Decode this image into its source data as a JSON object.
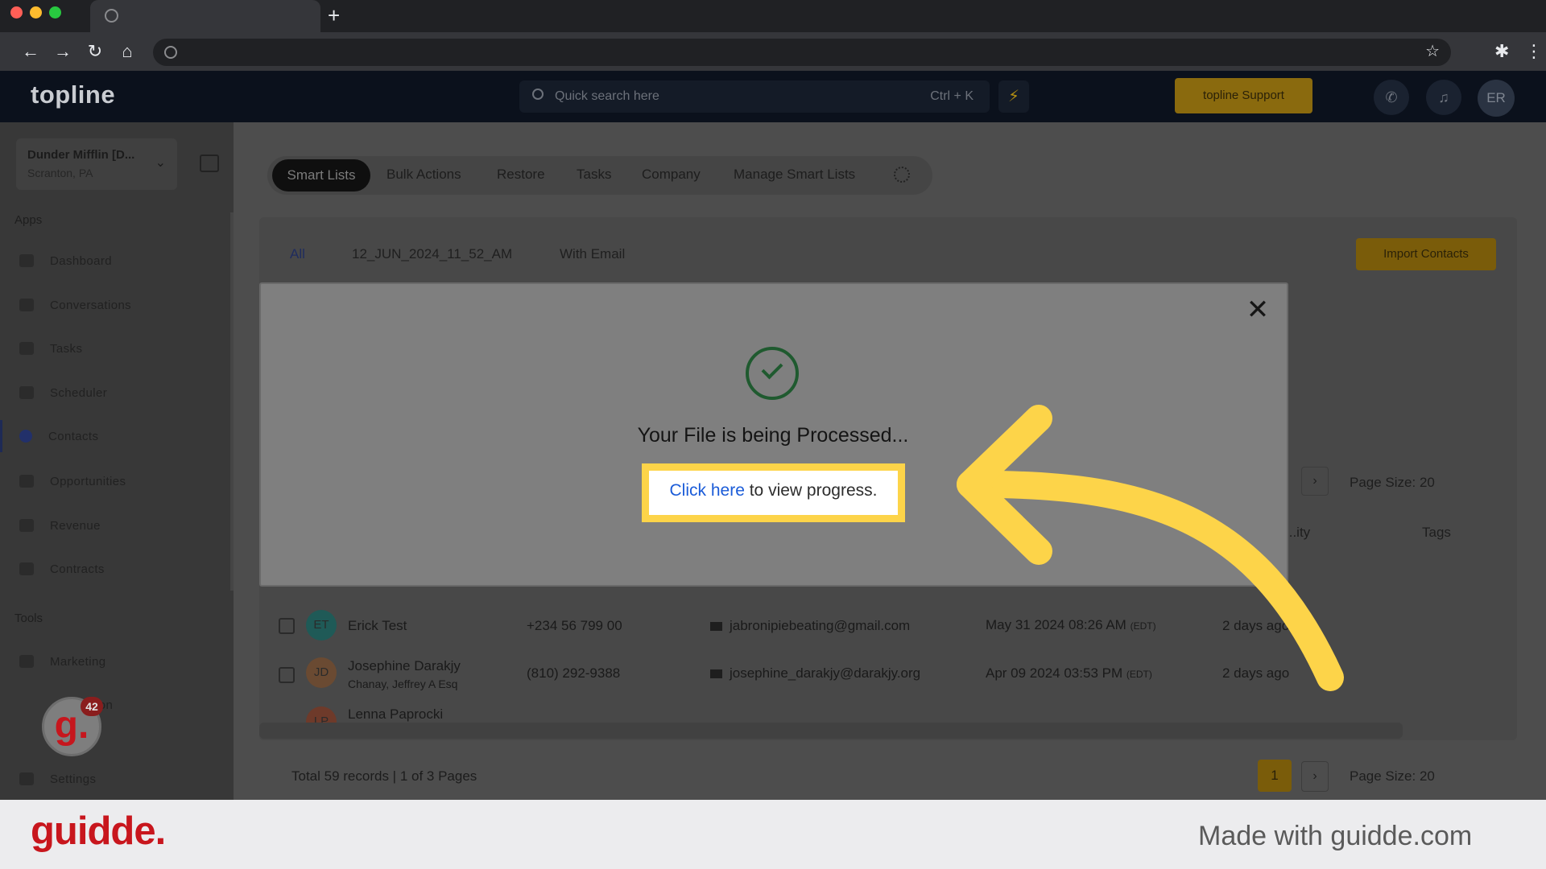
{
  "browser": {
    "new_tab_glyph": "+",
    "back_icon": "arrow-left-icon",
    "forward_icon": "arrow-right-icon"
  },
  "header": {
    "logo": "topline",
    "search_placeholder": "Quick search here",
    "search_shortcut": "Ctrl + K",
    "support_label": "topline Support",
    "avatar_initials": "ER"
  },
  "sidebar": {
    "location_name": "Dunder Mifflin [D...",
    "location_sub": "Scranton, PA",
    "apps_label": "Apps",
    "tools_label": "Tools",
    "items": [
      {
        "label": "Dashboard"
      },
      {
        "label": "Conversations"
      },
      {
        "label": "Tasks"
      },
      {
        "label": "Scheduler"
      },
      {
        "label": "Contacts"
      },
      {
        "label": "Opportunities"
      },
      {
        "label": "Revenue"
      },
      {
        "label": "Contracts"
      }
    ],
    "tool_items": [
      {
        "label": "Marketing"
      },
      {
        "label": "...ation"
      },
      {
        "label": "Settings"
      }
    ]
  },
  "tabs": {
    "active": "Smart Lists",
    "items": [
      "Bulk Actions",
      "Restore",
      "Tasks",
      "Company",
      "Manage Smart Lists"
    ]
  },
  "filters": {
    "all": "All",
    "list1": "12_JUN_2024_11_52_AM",
    "list2": "With Email",
    "import_label": "Import Contacts"
  },
  "table": {
    "page_size": "Page Size: 20",
    "activity_head": "...ity",
    "tags_head": "Tags",
    "rows": [
      {
        "initials": "ET",
        "name": "Erick Test",
        "sub": "",
        "phone": "+234 56 799 00",
        "email": "jabronipiebeating@gmail.com",
        "date": "May 31 2024 08:26 AM",
        "tz": "(EDT)",
        "activity": "2 days ago",
        "avatar_color": "#1f5a57"
      },
      {
        "initials": "JD",
        "name": "Josephine Darakjy",
        "sub": "Chanay, Jeffrey A Esq",
        "phone": "(810) 292-9388",
        "email": "josephine_darakjy@darakjy.org",
        "date": "Apr 09 2024 03:53 PM",
        "tz": "(EDT)",
        "activity": "2 days ago",
        "avatar_color": "#6a4a32"
      },
      {
        "initials": "LP",
        "name": "Lenna Paprocki",
        "sub": "",
        "phone": "",
        "email": "",
        "date": "",
        "tz": "",
        "activity": "",
        "avatar_color": "#6e3a2a"
      }
    ],
    "footer_total": "Total 59 records | 1 of 3 Pages",
    "current_page": "1",
    "next_glyph": "›"
  },
  "modal": {
    "title": "Your File is being Processed...",
    "link_text": "Click here",
    "rest_text": " to view progress.",
    "close_glyph": "✕"
  },
  "widget": {
    "letter": "g.",
    "badge": "42"
  },
  "banner": {
    "logo": "guidde.",
    "made_with": "Made with guidde.com"
  },
  "colors": {
    "highlight": "#fdd449",
    "arrow": "#fdd449",
    "brand_red": "#c8161d",
    "link_blue": "#1a5bd8"
  }
}
